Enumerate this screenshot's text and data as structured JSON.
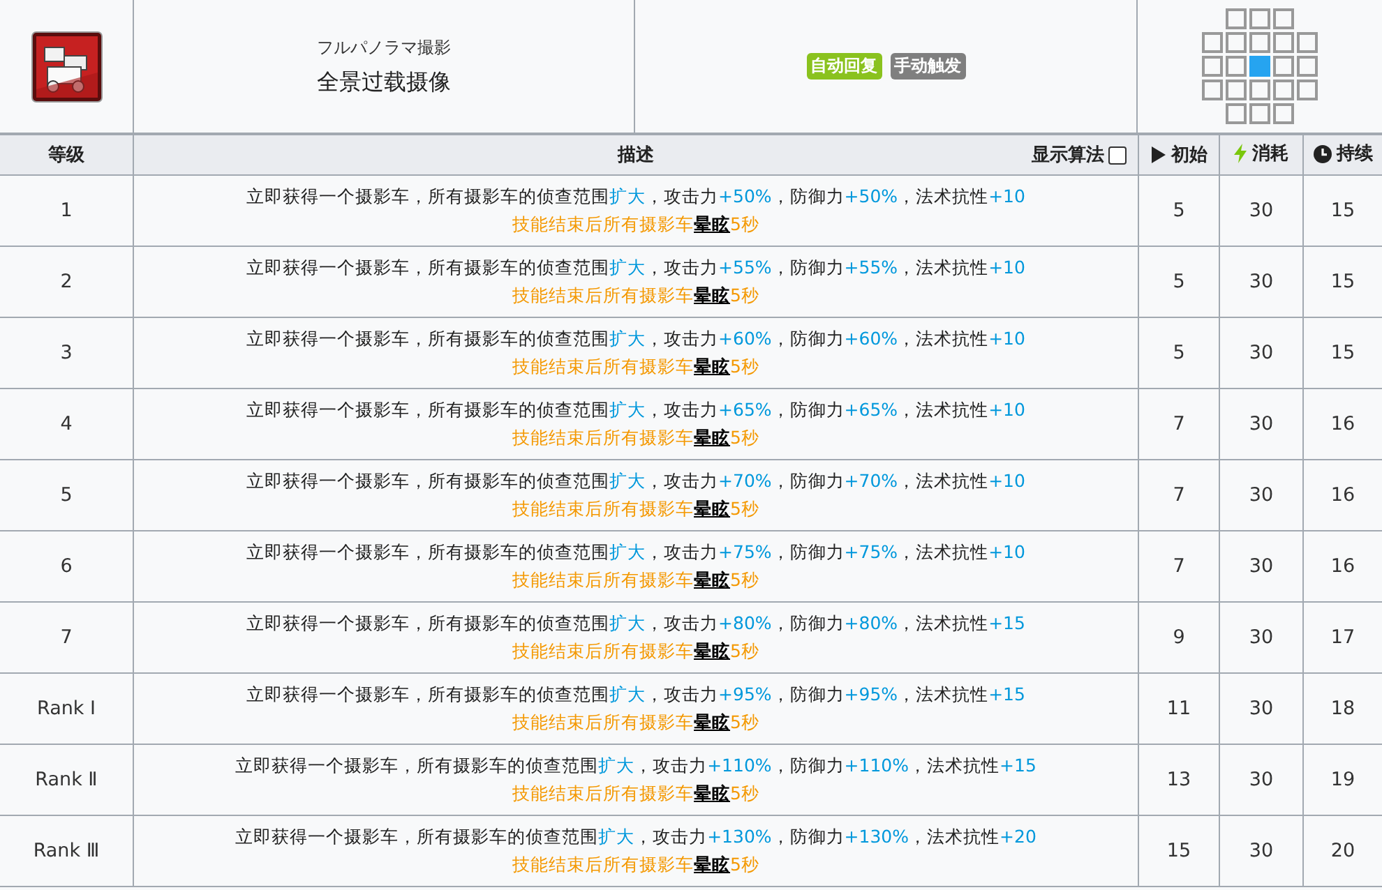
{
  "skill": {
    "subtitle": "フルパノラマ撮影",
    "name": "全景过载摄像",
    "tags": [
      {
        "label": "自动回复",
        "color": "#8ac21e"
      },
      {
        "label": "手动触发",
        "color": "#7f7f7f"
      }
    ],
    "range": [
      [
        {
          "kind": "empty"
        },
        {
          "kind": "tile"
        },
        {
          "kind": "tile"
        },
        {
          "kind": "tile"
        },
        {
          "kind": "empty"
        }
      ],
      [
        {
          "kind": "tile"
        },
        {
          "kind": "tile"
        },
        {
          "kind": "tile"
        },
        {
          "kind": "tile"
        },
        {
          "kind": "tile"
        }
      ],
      [
        {
          "kind": "tile"
        },
        {
          "kind": "tile"
        },
        {
          "kind": "self"
        },
        {
          "kind": "tile"
        },
        {
          "kind": "tile"
        }
      ],
      [
        {
          "kind": "tile"
        },
        {
          "kind": "tile"
        },
        {
          "kind": "tile"
        },
        {
          "kind": "tile"
        },
        {
          "kind": "tile"
        }
      ],
      [
        {
          "kind": "empty"
        },
        {
          "kind": "tile"
        },
        {
          "kind": "tile"
        },
        {
          "kind": "tile"
        },
        {
          "kind": "empty"
        }
      ]
    ]
  },
  "table": {
    "columns": [
      "等级",
      "描述",
      "初始",
      "消耗",
      "持续"
    ],
    "formula_toggle": {
      "label": "显示算法",
      "checked": false
    },
    "rows": [
      {
        "level": "1",
        "desc": [
          [
            {
              "kind": "plain",
              "text": "立即获得一个摄影车，所有摄影车的侦查范围"
            },
            {
              "kind": "value",
              "text": "扩大"
            },
            {
              "kind": "plain",
              "text": "，攻击力"
            },
            {
              "kind": "value",
              "text": "+50%"
            },
            {
              "kind": "plain",
              "text": "，防御力"
            },
            {
              "kind": "value",
              "text": "+50%"
            },
            {
              "kind": "plain",
              "text": "，法术抗性"
            },
            {
              "kind": "value",
              "text": "+10"
            }
          ],
          [
            {
              "kind": "effect",
              "text": "技能结束后所有摄影车"
            },
            {
              "kind": "keyword",
              "text": "晕眩"
            },
            {
              "kind": "effect",
              "text": "5秒"
            }
          ]
        ],
        "initial": "5",
        "cost": "30",
        "duration": "15"
      },
      {
        "level": "2",
        "desc": [
          [
            {
              "kind": "plain",
              "text": "立即获得一个摄影车，所有摄影车的侦查范围"
            },
            {
              "kind": "value",
              "text": "扩大"
            },
            {
              "kind": "plain",
              "text": "，攻击力"
            },
            {
              "kind": "value",
              "text": "+55%"
            },
            {
              "kind": "plain",
              "text": "，防御力"
            },
            {
              "kind": "value",
              "text": "+55%"
            },
            {
              "kind": "plain",
              "text": "，法术抗性"
            },
            {
              "kind": "value",
              "text": "+10"
            }
          ],
          [
            {
              "kind": "effect",
              "text": "技能结束后所有摄影车"
            },
            {
              "kind": "keyword",
              "text": "晕眩"
            },
            {
              "kind": "effect",
              "text": "5秒"
            }
          ]
        ],
        "initial": "5",
        "cost": "30",
        "duration": "15"
      },
      {
        "level": "3",
        "desc": [
          [
            {
              "kind": "plain",
              "text": "立即获得一个摄影车，所有摄影车的侦查范围"
            },
            {
              "kind": "value",
              "text": "扩大"
            },
            {
              "kind": "plain",
              "text": "，攻击力"
            },
            {
              "kind": "value",
              "text": "+60%"
            },
            {
              "kind": "plain",
              "text": "，防御力"
            },
            {
              "kind": "value",
              "text": "+60%"
            },
            {
              "kind": "plain",
              "text": "，法术抗性"
            },
            {
              "kind": "value",
              "text": "+10"
            }
          ],
          [
            {
              "kind": "effect",
              "text": "技能结束后所有摄影车"
            },
            {
              "kind": "keyword",
              "text": "晕眩"
            },
            {
              "kind": "effect",
              "text": "5秒"
            }
          ]
        ],
        "initial": "5",
        "cost": "30",
        "duration": "15"
      },
      {
        "level": "4",
        "desc": [
          [
            {
              "kind": "plain",
              "text": "立即获得一个摄影车，所有摄影车的侦查范围"
            },
            {
              "kind": "value",
              "text": "扩大"
            },
            {
              "kind": "plain",
              "text": "，攻击力"
            },
            {
              "kind": "value",
              "text": "+65%"
            },
            {
              "kind": "plain",
              "text": "，防御力"
            },
            {
              "kind": "value",
              "text": "+65%"
            },
            {
              "kind": "plain",
              "text": "，法术抗性"
            },
            {
              "kind": "value",
              "text": "+10"
            }
          ],
          [
            {
              "kind": "effect",
              "text": "技能结束后所有摄影车"
            },
            {
              "kind": "keyword",
              "text": "晕眩"
            },
            {
              "kind": "effect",
              "text": "5秒"
            }
          ]
        ],
        "initial": "7",
        "cost": "30",
        "duration": "16"
      },
      {
        "level": "5",
        "desc": [
          [
            {
              "kind": "plain",
              "text": "立即获得一个摄影车，所有摄影车的侦查范围"
            },
            {
              "kind": "value",
              "text": "扩大"
            },
            {
              "kind": "plain",
              "text": "，攻击力"
            },
            {
              "kind": "value",
              "text": "+70%"
            },
            {
              "kind": "plain",
              "text": "，防御力"
            },
            {
              "kind": "value",
              "text": "+70%"
            },
            {
              "kind": "plain",
              "text": "，法术抗性"
            },
            {
              "kind": "value",
              "text": "+10"
            }
          ],
          [
            {
              "kind": "effect",
              "text": "技能结束后所有摄影车"
            },
            {
              "kind": "keyword",
              "text": "晕眩"
            },
            {
              "kind": "effect",
              "text": "5秒"
            }
          ]
        ],
        "initial": "7",
        "cost": "30",
        "duration": "16"
      },
      {
        "level": "6",
        "desc": [
          [
            {
              "kind": "plain",
              "text": "立即获得一个摄影车，所有摄影车的侦查范围"
            },
            {
              "kind": "value",
              "text": "扩大"
            },
            {
              "kind": "plain",
              "text": "，攻击力"
            },
            {
              "kind": "value",
              "text": "+75%"
            },
            {
              "kind": "plain",
              "text": "，防御力"
            },
            {
              "kind": "value",
              "text": "+75%"
            },
            {
              "kind": "plain",
              "text": "，法术抗性"
            },
            {
              "kind": "value",
              "text": "+10"
            }
          ],
          [
            {
              "kind": "effect",
              "text": "技能结束后所有摄影车"
            },
            {
              "kind": "keyword",
              "text": "晕眩"
            },
            {
              "kind": "effect",
              "text": "5秒"
            }
          ]
        ],
        "initial": "7",
        "cost": "30",
        "duration": "16"
      },
      {
        "level": "7",
        "desc": [
          [
            {
              "kind": "plain",
              "text": "立即获得一个摄影车，所有摄影车的侦查范围"
            },
            {
              "kind": "value",
              "text": "扩大"
            },
            {
              "kind": "plain",
              "text": "，攻击力"
            },
            {
              "kind": "value",
              "text": "+80%"
            },
            {
              "kind": "plain",
              "text": "，防御力"
            },
            {
              "kind": "value",
              "text": "+80%"
            },
            {
              "kind": "plain",
              "text": "，法术抗性"
            },
            {
              "kind": "value",
              "text": "+15"
            }
          ],
          [
            {
              "kind": "effect",
              "text": "技能结束后所有摄影车"
            },
            {
              "kind": "keyword",
              "text": "晕眩"
            },
            {
              "kind": "effect",
              "text": "5秒"
            }
          ]
        ],
        "initial": "9",
        "cost": "30",
        "duration": "17"
      },
      {
        "level": "Rank Ⅰ",
        "desc": [
          [
            {
              "kind": "plain",
              "text": "立即获得一个摄影车，所有摄影车的侦查范围"
            },
            {
              "kind": "value",
              "text": "扩大"
            },
            {
              "kind": "plain",
              "text": "，攻击力"
            },
            {
              "kind": "value",
              "text": "+95%"
            },
            {
              "kind": "plain",
              "text": "，防御力"
            },
            {
              "kind": "value",
              "text": "+95%"
            },
            {
              "kind": "plain",
              "text": "，法术抗性"
            },
            {
              "kind": "value",
              "text": "+15"
            }
          ],
          [
            {
              "kind": "effect",
              "text": "技能结束后所有摄影车"
            },
            {
              "kind": "keyword",
              "text": "晕眩"
            },
            {
              "kind": "effect",
              "text": "5秒"
            }
          ]
        ],
        "initial": "11",
        "cost": "30",
        "duration": "18"
      },
      {
        "level": "Rank Ⅱ",
        "desc": [
          [
            {
              "kind": "plain",
              "text": "立即获得一个摄影车，所有摄影车的侦查范围"
            },
            {
              "kind": "value",
              "text": "扩大"
            },
            {
              "kind": "plain",
              "text": "，攻击力"
            },
            {
              "kind": "value",
              "text": "+110%"
            },
            {
              "kind": "plain",
              "text": "，防御力"
            },
            {
              "kind": "value",
              "text": "+110%"
            },
            {
              "kind": "plain",
              "text": "，法术抗性"
            },
            {
              "kind": "value",
              "text": "+15"
            }
          ],
          [
            {
              "kind": "effect",
              "text": "技能结束后所有摄影车"
            },
            {
              "kind": "keyword",
              "text": "晕眩"
            },
            {
              "kind": "effect",
              "text": "5秒"
            }
          ]
        ],
        "initial": "13",
        "cost": "30",
        "duration": "19"
      },
      {
        "level": "Rank Ⅲ",
        "desc": [
          [
            {
              "kind": "plain",
              "text": "立即获得一个摄影车，所有摄影车的侦查范围"
            },
            {
              "kind": "value",
              "text": "扩大"
            },
            {
              "kind": "plain",
              "text": "，攻击力"
            },
            {
              "kind": "value",
              "text": "+130%"
            },
            {
              "kind": "plain",
              "text": "，防御力"
            },
            {
              "kind": "value",
              "text": "+130%"
            },
            {
              "kind": "plain",
              "text": "，法术抗性"
            },
            {
              "kind": "value",
              "text": "+20"
            }
          ],
          [
            {
              "kind": "effect",
              "text": "技能结束后所有摄影车"
            },
            {
              "kind": "keyword",
              "text": "晕眩"
            },
            {
              "kind": "effect",
              "text": "5秒"
            }
          ]
        ],
        "initial": "15",
        "cost": "30",
        "duration": "20"
      }
    ]
  }
}
